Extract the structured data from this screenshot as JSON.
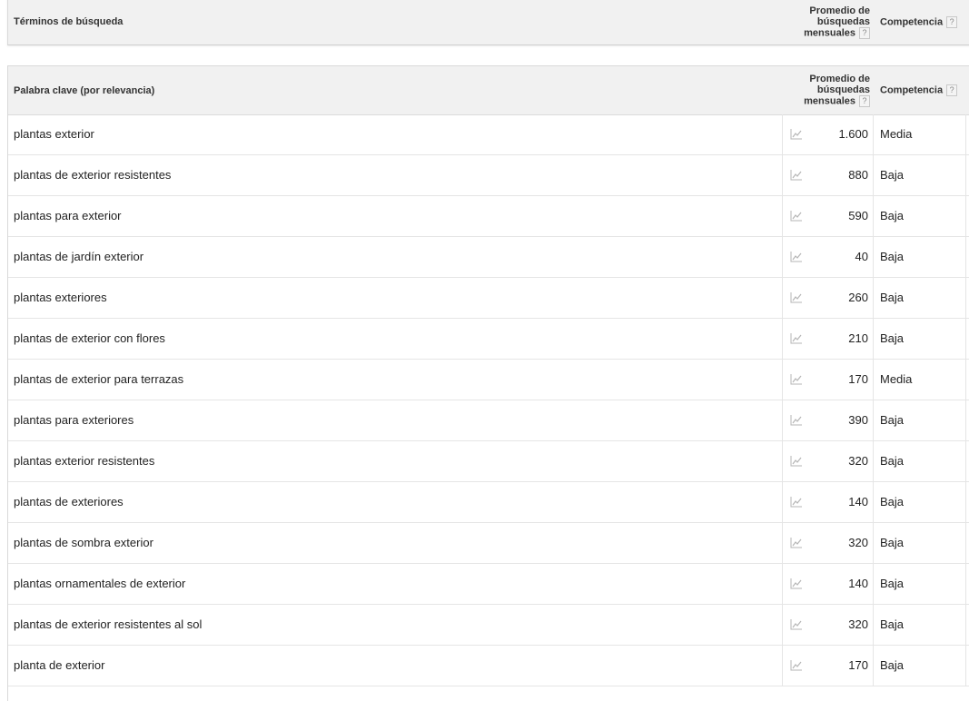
{
  "search_terms": {
    "header_label": "Términos de búsqueda",
    "avg_header": [
      "Promedio de",
      "búsquedas",
      "mensuales"
    ],
    "competition_header": "Competencia",
    "help_glyph": "?"
  },
  "keywords": {
    "header_label": "Palabra clave (por relevancia)",
    "avg_header": [
      "Promedio de",
      "búsquedas",
      "mensuales"
    ],
    "competition_header": "Competencia",
    "help_glyph": "?",
    "trend_icon": "line-chart-icon",
    "rows": [
      {
        "keyword": "plantas exterior",
        "volume": "1.600",
        "competition": "Media"
      },
      {
        "keyword": "plantas de exterior resistentes",
        "volume": "880",
        "competition": "Baja"
      },
      {
        "keyword": "plantas para exterior",
        "volume": "590",
        "competition": "Baja"
      },
      {
        "keyword": "plantas de jardín exterior",
        "volume": "40",
        "competition": "Baja"
      },
      {
        "keyword": "plantas exteriores",
        "volume": "260",
        "competition": "Baja"
      },
      {
        "keyword": "plantas de exterior con flores",
        "volume": "210",
        "competition": "Baja"
      },
      {
        "keyword": "plantas de exterior para terrazas",
        "volume": "170",
        "competition": "Media"
      },
      {
        "keyword": "plantas para exteriores",
        "volume": "390",
        "competition": "Baja"
      },
      {
        "keyword": "plantas exterior resistentes",
        "volume": "320",
        "competition": "Baja"
      },
      {
        "keyword": "plantas de exteriores",
        "volume": "140",
        "competition": "Baja"
      },
      {
        "keyword": "plantas de sombra exterior",
        "volume": "320",
        "competition": "Baja"
      },
      {
        "keyword": "plantas ornamentales de exterior",
        "volume": "140",
        "competition": "Baja"
      },
      {
        "keyword": "plantas de exterior resistentes al sol",
        "volume": "320",
        "competition": "Baja"
      },
      {
        "keyword": "planta de exterior",
        "volume": "170",
        "competition": "Baja"
      }
    ]
  }
}
